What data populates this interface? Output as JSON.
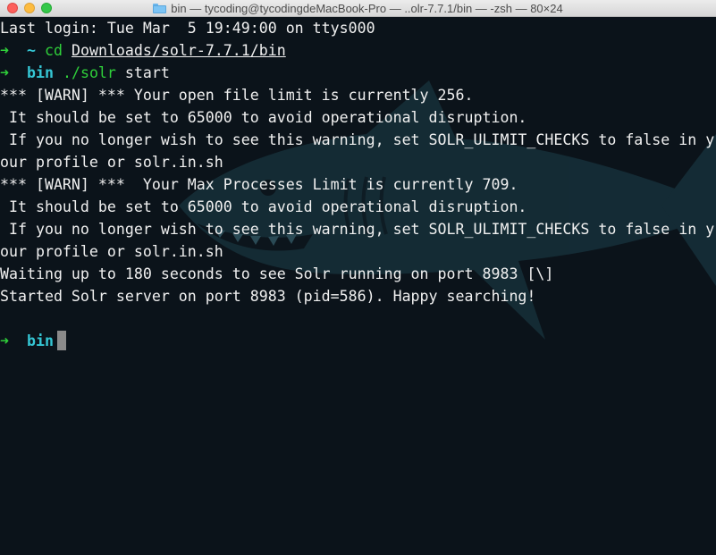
{
  "window": {
    "title": "bin — tycoding@tycodingdeMacBook-Pro — ..olr-7.7.1/bin — -zsh — 80×24"
  },
  "terminal": {
    "login_line": "Last login: Tue Mar  5 19:49:00 on ttys000",
    "prompt_arrow": "➜",
    "prompt1_tilde": "~",
    "prompt1_cmd": "cd",
    "prompt1_arg": "Downloads/solr-7.7.1/bin",
    "prompt2_dir": "bin",
    "prompt2_cmd": "./solr",
    "prompt2_arg": "start",
    "output": [
      "*** [WARN] *** Your open file limit is currently 256.",
      " It should be set to 65000 to avoid operational disruption.",
      " If you no longer wish to see this warning, set SOLR_ULIMIT_CHECKS to false in y",
      "our profile or solr.in.sh",
      "*** [WARN] ***  Your Max Processes Limit is currently 709.",
      " It should be set to 65000 to avoid operational disruption.",
      " If you no longer wish to see this warning, set SOLR_ULIMIT_CHECKS to false in y",
      "our profile or solr.in.sh",
      "Waiting up to 180 seconds to see Solr running on port 8983 [\\]",
      "Started Solr server on port 8983 (pid=586). Happy searching!"
    ],
    "prompt3_dir": "bin"
  },
  "colors": {
    "background": "#0b131a",
    "prompt_green": "#2fd03a",
    "prompt_cyan": "#35c6d4",
    "text": "#f0f0f0"
  }
}
